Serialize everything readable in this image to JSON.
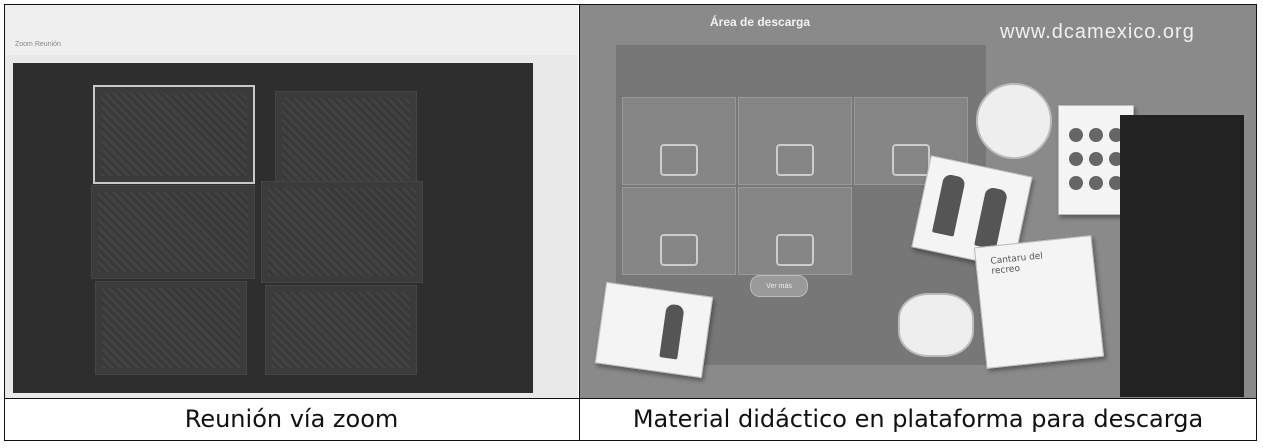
{
  "captions": {
    "left": "Reunión vía zoom",
    "right": "Material didáctico en plataforma para descarga"
  },
  "left_image": {
    "window_title": "Zoom Reunión",
    "tiles": 6
  },
  "right_image": {
    "url": "www.dcamexico.org",
    "panel_title": "Área de descarga",
    "card_text": "Cantaru del recreo",
    "button_label": "Ver más",
    "colors": {
      "background": "#8a8a8a",
      "panel": "#777777",
      "text": "#f0f0f0"
    }
  }
}
